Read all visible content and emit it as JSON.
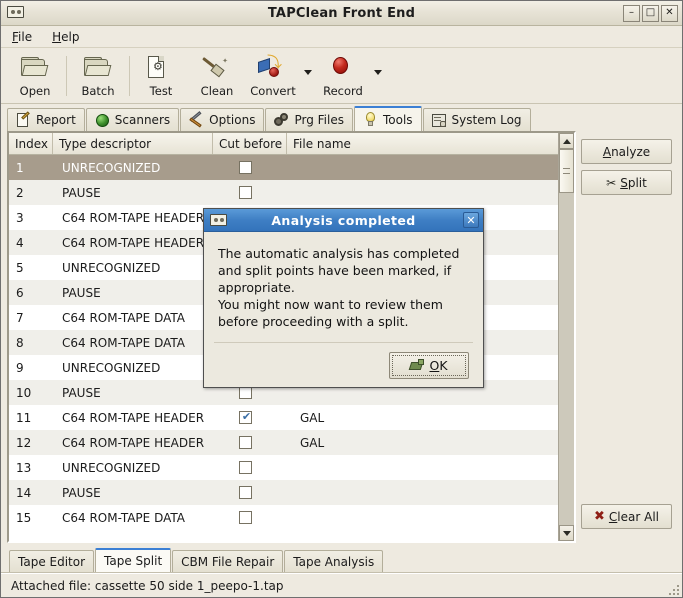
{
  "window": {
    "title": "TAPClean Front End",
    "icon": "cassette-icon",
    "buttons": {
      "minimize": "–",
      "maximize": "□",
      "close": "✕"
    }
  },
  "menubar": {
    "items": [
      {
        "label": "File",
        "mnemonic": "F"
      },
      {
        "label": "Help",
        "mnemonic": "H"
      }
    ]
  },
  "toolbar": {
    "items": [
      {
        "label": "Open",
        "icon": "folder-open-icon",
        "has_dropdown": false
      },
      {
        "label": "Batch",
        "icon": "folder-batch-icon",
        "has_dropdown": false
      },
      {
        "label": "Test",
        "icon": "document-test-icon",
        "has_dropdown": false
      },
      {
        "label": "Clean",
        "icon": "broom-icon",
        "has_dropdown": false
      },
      {
        "label": "Convert",
        "icon": "convert-icon",
        "has_dropdown": true
      },
      {
        "label": "Record",
        "icon": "record-icon",
        "has_dropdown": true
      }
    ]
  },
  "tabs": {
    "active": "Tools",
    "items": [
      {
        "label": "Report",
        "icon": "report-icon",
        "active": false
      },
      {
        "label": "Scanners",
        "icon": "sphere-icon",
        "active": false
      },
      {
        "label": "Options",
        "icon": "tools-icon",
        "active": false
      },
      {
        "label": "Prg Files",
        "icon": "gears-icon",
        "active": false
      },
      {
        "label": "Tools",
        "icon": "bulb-icon",
        "active": true
      },
      {
        "label": "System Log",
        "icon": "log-icon",
        "active": false
      }
    ]
  },
  "table": {
    "columns": [
      "Index",
      "Type descriptor",
      "Cut before",
      "File name"
    ],
    "rows": [
      {
        "index": "1",
        "type": "UNRECOGNIZED",
        "cut": false,
        "file": "",
        "selected": true
      },
      {
        "index": "2",
        "type": "PAUSE",
        "cut": false,
        "file": "",
        "selected": false
      },
      {
        "index": "3",
        "type": "C64 ROM-TAPE HEADER",
        "cut": false,
        "file": "",
        "selected": false
      },
      {
        "index": "4",
        "type": "C64 ROM-TAPE HEADER",
        "cut": false,
        "file": "",
        "selected": false
      },
      {
        "index": "5",
        "type": "UNRECOGNIZED",
        "cut": false,
        "file": "",
        "selected": false
      },
      {
        "index": "6",
        "type": "PAUSE",
        "cut": false,
        "file": "",
        "selected": false
      },
      {
        "index": "7",
        "type": "C64 ROM-TAPE DATA",
        "cut": false,
        "file": "",
        "selected": false
      },
      {
        "index": "8",
        "type": "C64 ROM-TAPE DATA",
        "cut": false,
        "file": "",
        "selected": false
      },
      {
        "index": "9",
        "type": "UNRECOGNIZED",
        "cut": false,
        "file": "",
        "selected": false
      },
      {
        "index": "10",
        "type": "PAUSE",
        "cut": false,
        "file": "",
        "selected": false
      },
      {
        "index": "11",
        "type": "C64 ROM-TAPE HEADER",
        "cut": true,
        "file": "GAL",
        "selected": false
      },
      {
        "index": "12",
        "type": "C64 ROM-TAPE HEADER",
        "cut": false,
        "file": "GAL",
        "selected": false
      },
      {
        "index": "13",
        "type": "UNRECOGNIZED",
        "cut": false,
        "file": "",
        "selected": false
      },
      {
        "index": "14",
        "type": "PAUSE",
        "cut": false,
        "file": "",
        "selected": false
      },
      {
        "index": "15",
        "type": "C64 ROM-TAPE DATA",
        "cut": false,
        "file": "",
        "selected": false
      }
    ]
  },
  "side_buttons": {
    "analyze": {
      "label": "Analyze",
      "mnemonic": "A"
    },
    "split": {
      "label": "Split",
      "mnemonic": "S",
      "icon": "scissors-icon"
    },
    "clear_all": {
      "label": "Clear All",
      "mnemonic": "C",
      "icon": "x-mark-icon"
    }
  },
  "bottom_tabs": {
    "active": "Tape Split",
    "items": [
      {
        "label": "Tape Editor",
        "active": false
      },
      {
        "label": "Tape Split",
        "active": true
      },
      {
        "label": "CBM File Repair",
        "active": false
      },
      {
        "label": "Tape Analysis",
        "active": false
      }
    ]
  },
  "statusbar": {
    "text": "Attached file: cassette 50 side 1_peepo-1.tap"
  },
  "dialog": {
    "title": "Analysis completed",
    "icon": "cassette-icon",
    "close_label": "✕",
    "lines": [
      "The automatic analysis has completed",
      "and split points have been marked, if",
      "appropriate.",
      "You might now want to review them",
      "before proceeding with a split."
    ],
    "ok": {
      "label": "OK",
      "mnemonic": "O",
      "icon": "hand-pointer-icon"
    }
  },
  "colors": {
    "accent": "#3b7fd4",
    "dialog_title": "#3f7fc4",
    "selection": "#a79c8c",
    "window_bg": "#eeeae0",
    "checkmark": "#3a6ea5"
  }
}
